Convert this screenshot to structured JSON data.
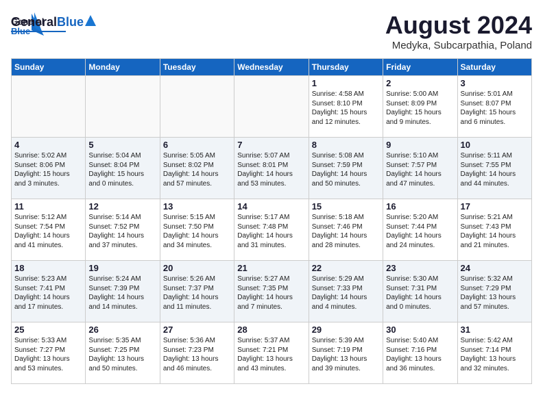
{
  "header": {
    "logo_general": "General",
    "logo_blue": "Blue",
    "title": "August 2024",
    "location": "Medyka, Subcarpathia, Poland"
  },
  "weekdays": [
    "Sunday",
    "Monday",
    "Tuesday",
    "Wednesday",
    "Thursday",
    "Friday",
    "Saturday"
  ],
  "weeks": [
    [
      {
        "day": "",
        "info": ""
      },
      {
        "day": "",
        "info": ""
      },
      {
        "day": "",
        "info": ""
      },
      {
        "day": "",
        "info": ""
      },
      {
        "day": "1",
        "info": "Sunrise: 4:58 AM\nSunset: 8:10 PM\nDaylight: 15 hours\nand 12 minutes."
      },
      {
        "day": "2",
        "info": "Sunrise: 5:00 AM\nSunset: 8:09 PM\nDaylight: 15 hours\nand 9 minutes."
      },
      {
        "day": "3",
        "info": "Sunrise: 5:01 AM\nSunset: 8:07 PM\nDaylight: 15 hours\nand 6 minutes."
      }
    ],
    [
      {
        "day": "4",
        "info": "Sunrise: 5:02 AM\nSunset: 8:06 PM\nDaylight: 15 hours\nand 3 minutes."
      },
      {
        "day": "5",
        "info": "Sunrise: 5:04 AM\nSunset: 8:04 PM\nDaylight: 15 hours\nand 0 minutes."
      },
      {
        "day": "6",
        "info": "Sunrise: 5:05 AM\nSunset: 8:02 PM\nDaylight: 14 hours\nand 57 minutes."
      },
      {
        "day": "7",
        "info": "Sunrise: 5:07 AM\nSunset: 8:01 PM\nDaylight: 14 hours\nand 53 minutes."
      },
      {
        "day": "8",
        "info": "Sunrise: 5:08 AM\nSunset: 7:59 PM\nDaylight: 14 hours\nand 50 minutes."
      },
      {
        "day": "9",
        "info": "Sunrise: 5:10 AM\nSunset: 7:57 PM\nDaylight: 14 hours\nand 47 minutes."
      },
      {
        "day": "10",
        "info": "Sunrise: 5:11 AM\nSunset: 7:55 PM\nDaylight: 14 hours\nand 44 minutes."
      }
    ],
    [
      {
        "day": "11",
        "info": "Sunrise: 5:12 AM\nSunset: 7:54 PM\nDaylight: 14 hours\nand 41 minutes."
      },
      {
        "day": "12",
        "info": "Sunrise: 5:14 AM\nSunset: 7:52 PM\nDaylight: 14 hours\nand 37 minutes."
      },
      {
        "day": "13",
        "info": "Sunrise: 5:15 AM\nSunset: 7:50 PM\nDaylight: 14 hours\nand 34 minutes."
      },
      {
        "day": "14",
        "info": "Sunrise: 5:17 AM\nSunset: 7:48 PM\nDaylight: 14 hours\nand 31 minutes."
      },
      {
        "day": "15",
        "info": "Sunrise: 5:18 AM\nSunset: 7:46 PM\nDaylight: 14 hours\nand 28 minutes."
      },
      {
        "day": "16",
        "info": "Sunrise: 5:20 AM\nSunset: 7:44 PM\nDaylight: 14 hours\nand 24 minutes."
      },
      {
        "day": "17",
        "info": "Sunrise: 5:21 AM\nSunset: 7:43 PM\nDaylight: 14 hours\nand 21 minutes."
      }
    ],
    [
      {
        "day": "18",
        "info": "Sunrise: 5:23 AM\nSunset: 7:41 PM\nDaylight: 14 hours\nand 17 minutes."
      },
      {
        "day": "19",
        "info": "Sunrise: 5:24 AM\nSunset: 7:39 PM\nDaylight: 14 hours\nand 14 minutes."
      },
      {
        "day": "20",
        "info": "Sunrise: 5:26 AM\nSunset: 7:37 PM\nDaylight: 14 hours\nand 11 minutes."
      },
      {
        "day": "21",
        "info": "Sunrise: 5:27 AM\nSunset: 7:35 PM\nDaylight: 14 hours\nand 7 minutes."
      },
      {
        "day": "22",
        "info": "Sunrise: 5:29 AM\nSunset: 7:33 PM\nDaylight: 14 hours\nand 4 minutes."
      },
      {
        "day": "23",
        "info": "Sunrise: 5:30 AM\nSunset: 7:31 PM\nDaylight: 14 hours\nand 0 minutes."
      },
      {
        "day": "24",
        "info": "Sunrise: 5:32 AM\nSunset: 7:29 PM\nDaylight: 13 hours\nand 57 minutes."
      }
    ],
    [
      {
        "day": "25",
        "info": "Sunrise: 5:33 AM\nSunset: 7:27 PM\nDaylight: 13 hours\nand 53 minutes."
      },
      {
        "day": "26",
        "info": "Sunrise: 5:35 AM\nSunset: 7:25 PM\nDaylight: 13 hours\nand 50 minutes."
      },
      {
        "day": "27",
        "info": "Sunrise: 5:36 AM\nSunset: 7:23 PM\nDaylight: 13 hours\nand 46 minutes."
      },
      {
        "day": "28",
        "info": "Sunrise: 5:37 AM\nSunset: 7:21 PM\nDaylight: 13 hours\nand 43 minutes."
      },
      {
        "day": "29",
        "info": "Sunrise: 5:39 AM\nSunset: 7:19 PM\nDaylight: 13 hours\nand 39 minutes."
      },
      {
        "day": "30",
        "info": "Sunrise: 5:40 AM\nSunset: 7:16 PM\nDaylight: 13 hours\nand 36 minutes."
      },
      {
        "day": "31",
        "info": "Sunrise: 5:42 AM\nSunset: 7:14 PM\nDaylight: 13 hours\nand 32 minutes."
      }
    ]
  ]
}
